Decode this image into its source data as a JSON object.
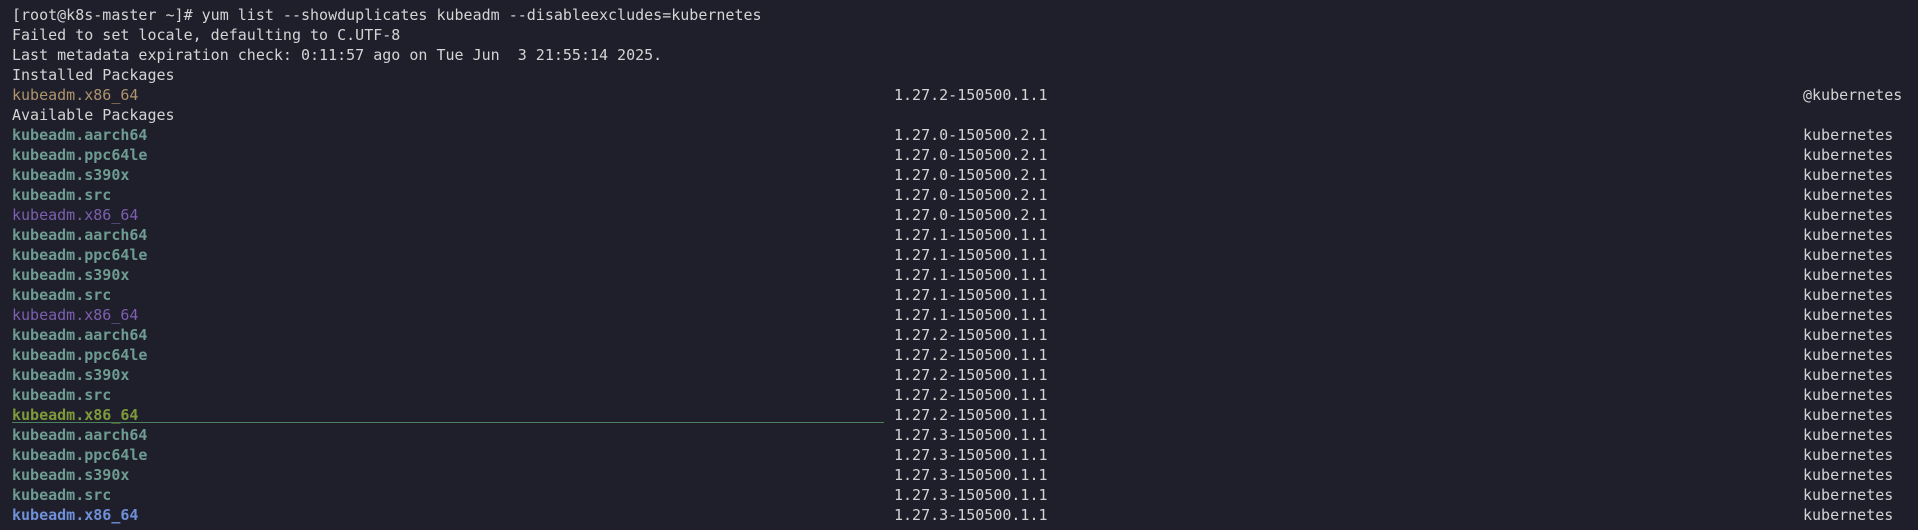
{
  "terminal": {
    "prompt_line": "[root@k8s-master ~]# yum list --showduplicates kubeadm --disableexcludes=kubernetes",
    "locale_warning": "Failed to set locale, defaulting to C.UTF-8",
    "metadata_line": "Last metadata expiration check: 0:11:57 ago on Tue Jun  3 21:55:14 2025.",
    "installed_header": "Installed Packages",
    "available_header": "Available Packages",
    "colors": {
      "background": "#1e1f2b",
      "text": "#d4d4d4",
      "pkg_bold_teal": "#6e9c93",
      "pkg_installed": "#b0936b",
      "pkg_purple": "#7e5fb0",
      "pkg_olive": "#7f9a3a",
      "pkg_blue": "#6f8fd8"
    }
  },
  "installed": [
    {
      "name": "kubeadm.x86_64",
      "version": "1.27.2-150500.1.1",
      "repo": "@kubernetes",
      "style": "installed"
    }
  ],
  "available": [
    {
      "name": "kubeadm.aarch64",
      "version": "1.27.0-150500.2.1",
      "repo": "kubernetes",
      "style": "bold"
    },
    {
      "name": "kubeadm.ppc64le",
      "version": "1.27.0-150500.2.1",
      "repo": "kubernetes",
      "style": "bold"
    },
    {
      "name": "kubeadm.s390x",
      "version": "1.27.0-150500.2.1",
      "repo": "kubernetes",
      "style": "bold"
    },
    {
      "name": "kubeadm.src",
      "version": "1.27.0-150500.2.1",
      "repo": "kubernetes",
      "style": "bold"
    },
    {
      "name": "kubeadm.x86_64",
      "version": "1.27.0-150500.2.1",
      "repo": "kubernetes",
      "style": "purple"
    },
    {
      "name": "kubeadm.aarch64",
      "version": "1.27.1-150500.1.1",
      "repo": "kubernetes",
      "style": "bold"
    },
    {
      "name": "kubeadm.ppc64le",
      "version": "1.27.1-150500.1.1",
      "repo": "kubernetes",
      "style": "bold"
    },
    {
      "name": "kubeadm.s390x",
      "version": "1.27.1-150500.1.1",
      "repo": "kubernetes",
      "style": "bold"
    },
    {
      "name": "kubeadm.src",
      "version": "1.27.1-150500.1.1",
      "repo": "kubernetes",
      "style": "bold"
    },
    {
      "name": "kubeadm.x86_64",
      "version": "1.27.1-150500.1.1",
      "repo": "kubernetes",
      "style": "purple"
    },
    {
      "name": "kubeadm.aarch64",
      "version": "1.27.2-150500.1.1",
      "repo": "kubernetes",
      "style": "bold"
    },
    {
      "name": "kubeadm.ppc64le",
      "version": "1.27.2-150500.1.1",
      "repo": "kubernetes",
      "style": "bold"
    },
    {
      "name": "kubeadm.s390x",
      "version": "1.27.2-150500.1.1",
      "repo": "kubernetes",
      "style": "bold"
    },
    {
      "name": "kubeadm.src",
      "version": "1.27.2-150500.1.1",
      "repo": "kubernetes",
      "style": "bold"
    },
    {
      "name": "kubeadm.x86_64",
      "version": "1.27.2-150500.1.1",
      "repo": "kubernetes",
      "style": "olive"
    },
    {
      "name": "kubeadm.aarch64",
      "version": "1.27.3-150500.1.1",
      "repo": "kubernetes",
      "style": "bold"
    },
    {
      "name": "kubeadm.ppc64le",
      "version": "1.27.3-150500.1.1",
      "repo": "kubernetes",
      "style": "bold"
    },
    {
      "name": "kubeadm.s390x",
      "version": "1.27.3-150500.1.1",
      "repo": "kubernetes",
      "style": "bold"
    },
    {
      "name": "kubeadm.src",
      "version": "1.27.3-150500.1.1",
      "repo": "kubernetes",
      "style": "bold"
    },
    {
      "name": "kubeadm.x86_64",
      "version": "1.27.3-150500.1.1",
      "repo": "kubernetes",
      "style": "blue"
    }
  ]
}
